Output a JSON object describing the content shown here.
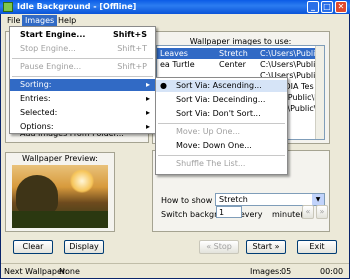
{
  "window": {
    "title": "Idle Background - [Offline]",
    "minimize": "_",
    "maximize": "□",
    "close": "✕"
  },
  "menubar": {
    "file": "File",
    "images": "Images",
    "help": "Help"
  },
  "images_menu": {
    "start_engine": "Start Engine...",
    "start_engine_shortcut": "Shift+S",
    "stop_engine": "Stop Engine...",
    "stop_engine_shortcut": "Shift+T",
    "pause_engine": "Pause Engine...",
    "pause_engine_shortcut": "Shift+P",
    "sorting": "Sorting:",
    "entries": "Entries:",
    "selected": "Selected:",
    "options": "Options:"
  },
  "sorting_submenu": {
    "ascending": "Sort Via: Ascending...",
    "descending": "Sort Via: Deceinding...",
    "dont_sort": "Sort Via: Don't Sort...",
    "move_up": "Move: Up One...",
    "move_down": "Move: Down One...",
    "shuffle": "Shuffle The List..."
  },
  "wallpaper_list": {
    "heading": "Wallpaper images to use:",
    "rows": [
      {
        "name": "Leaves",
        "style": "Stretch",
        "path": "C:\\Users\\Public\\Pi"
      },
      {
        "name": "ea Turtle",
        "style": "Center",
        "path": "C:\\Users\\Public\\Pi"
      },
      {
        "name": "",
        "style": "",
        "path": "C:\\Users\\Public\\Pi"
      },
      {
        "name": "",
        "style": "",
        "path": "KIPEDIA Tes"
      },
      {
        "name": "",
        "style": "",
        "path": "\\Users\\Public\\Pi"
      },
      {
        "name": "",
        "style": "",
        "path": "Users\\Public\\Pi"
      }
    ]
  },
  "left_panel": {
    "add_from_folder": "Add Images From Folder..."
  },
  "preview": {
    "heading": "Wallpaper Preview:"
  },
  "settings": {
    "how_to_show_label": "How to show wallpaper:",
    "how_to_show_value": "Stretch",
    "switch_label": "Switch background every",
    "switch_value": "1",
    "switch_unit": "minute(s)",
    "prev": "«",
    "next": "»"
  },
  "buttons": {
    "clear": "Clear",
    "display": "Display",
    "stop": "« Stop",
    "start": "Start »",
    "exit": "Exit"
  },
  "status": {
    "next_label": "Next Wallpaper:",
    "next_value": "None",
    "images_label": "Images:",
    "images_value": "05",
    "time": "00:00"
  }
}
